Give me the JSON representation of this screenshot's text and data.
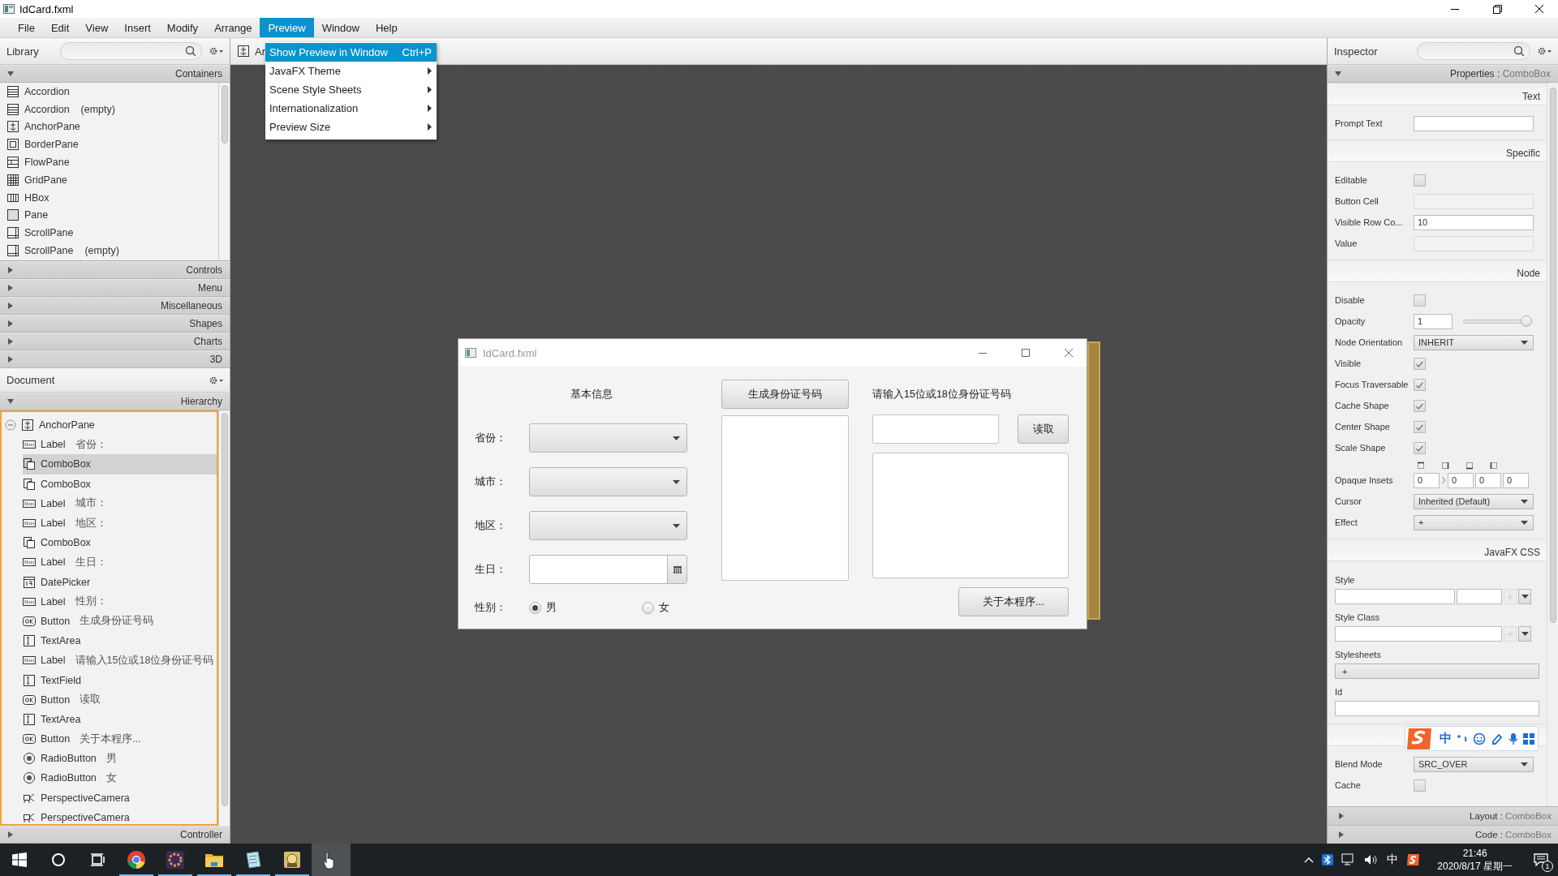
{
  "window": {
    "title": "IdCard.fxml"
  },
  "menu_bar": [
    {
      "label": "File",
      "selected": false
    },
    {
      "label": "Edit",
      "selected": false
    },
    {
      "label": "View",
      "selected": false
    },
    {
      "label": "Insert",
      "selected": false
    },
    {
      "label": "Modify",
      "selected": false
    },
    {
      "label": "Arrange",
      "selected": false
    },
    {
      "label": "Preview",
      "selected": true
    },
    {
      "label": "Window",
      "selected": false
    },
    {
      "label": "Help",
      "selected": false
    }
  ],
  "preview_menu": [
    {
      "label": "Show Preview in Window",
      "shortcut": "Ctrl+P",
      "selected": true,
      "submenu": false
    },
    {
      "label": "JavaFX Theme",
      "selected": false,
      "submenu": true
    },
    {
      "label": "Scene Style Sheets",
      "selected": false,
      "submenu": true
    },
    {
      "label": "Internationalization",
      "selected": false,
      "submenu": true
    },
    {
      "label": "Preview Size",
      "selected": false,
      "submenu": true
    }
  ],
  "library": {
    "title": "Library",
    "sections": [
      {
        "label": "Containers",
        "expanded": true,
        "items": [
          {
            "label": "Accordion",
            "kind": "accordion"
          },
          {
            "label": "Accordion",
            "note": "(empty)",
            "kind": "accordion"
          },
          {
            "label": "AnchorPane",
            "kind": "anchor"
          },
          {
            "label": "BorderPane",
            "kind": "border"
          },
          {
            "label": "FlowPane",
            "kind": "flow"
          },
          {
            "label": "GridPane",
            "kind": "grid"
          },
          {
            "label": "HBox",
            "kind": "hbox"
          },
          {
            "label": "Pane",
            "kind": "pane"
          },
          {
            "label": "ScrollPane",
            "kind": "scroll"
          },
          {
            "label": "ScrollPane",
            "note": "(empty)",
            "kind": "scroll"
          }
        ]
      },
      {
        "label": "Controls",
        "expanded": false
      },
      {
        "label": "Menu",
        "expanded": false
      },
      {
        "label": "Miscellaneous",
        "expanded": false
      },
      {
        "label": "Shapes",
        "expanded": false
      },
      {
        "label": "Charts",
        "expanded": false
      },
      {
        "label": "3D",
        "expanded": false
      }
    ]
  },
  "document": {
    "title": "Document",
    "section": "Hierarchy",
    "tree": [
      {
        "label": "AnchorPane",
        "kind": "anchor",
        "expanded": true,
        "selected": false,
        "children": [
          {
            "label": "Label",
            "detail": "省份：",
            "kind": "label",
            "selected": false
          },
          {
            "label": "ComboBox",
            "kind": "combo",
            "selected": true
          },
          {
            "label": "ComboBox",
            "kind": "combo",
            "selected": false
          },
          {
            "label": "Label",
            "detail": "城市：",
            "kind": "label",
            "selected": false
          },
          {
            "label": "Label",
            "detail": "地区：",
            "kind": "label",
            "selected": false
          },
          {
            "label": "ComboBox",
            "kind": "combo",
            "selected": false
          },
          {
            "label": "Label",
            "detail": "生日：",
            "kind": "label",
            "selected": false
          },
          {
            "label": "DatePicker",
            "kind": "date",
            "selected": false
          },
          {
            "label": "Label",
            "detail": "性别：",
            "kind": "label",
            "selected": false
          },
          {
            "label": "Button",
            "detail": "生成身份证号码",
            "kind": "button",
            "selected": false
          },
          {
            "label": "TextArea",
            "kind": "textarea",
            "selected": false
          },
          {
            "label": "Label",
            "detail": "请输入15位或18位身份证号码",
            "kind": "label",
            "selected": false
          },
          {
            "label": "TextField",
            "kind": "textarea",
            "selected": false
          },
          {
            "label": "Button",
            "detail": "读取",
            "kind": "button",
            "selected": false
          },
          {
            "label": "TextArea",
            "kind": "textarea",
            "selected": false
          },
          {
            "label": "Button",
            "detail": "关于本程序...",
            "kind": "button",
            "selected": false
          },
          {
            "label": "RadioButton",
            "detail": "男",
            "kind": "radio",
            "selected": false
          },
          {
            "label": "RadioButton",
            "detail": "女",
            "kind": "radio",
            "selected": false
          },
          {
            "label": "PerspectiveCamera",
            "kind": "camera",
            "selected": false
          },
          {
            "label": "PerspectiveCamera",
            "kind": "camera",
            "selected": false
          }
        ]
      }
    ],
    "footer": "Controller"
  },
  "canvas": {
    "breadcrumb": "Ar"
  },
  "preview_window": {
    "title": "IdCard.fxml",
    "heading": "基本信息",
    "fields": [
      {
        "label": "省份：",
        "kind": "combo"
      },
      {
        "label": "城市：",
        "kind": "combo"
      },
      {
        "label": "地区：",
        "kind": "combo"
      },
      {
        "label": "生日：",
        "kind": "date"
      }
    ],
    "gender_label": "性别：",
    "radios": [
      {
        "label": "男",
        "selected": true
      },
      {
        "label": "女",
        "selected": false
      }
    ],
    "generate_button": "生成身份证号码",
    "id_prompt": "请输入15位或18位身份证号码",
    "read_button": "读取",
    "about_button": "关于本程序..."
  },
  "inspector": {
    "title": "Inspector",
    "header": {
      "label": "Properties :",
      "target": "ComboBox"
    },
    "sections": [
      {
        "title": "Text",
        "rows": [
          {
            "label": "Prompt Text",
            "kind": "text"
          }
        ]
      },
      {
        "title": "Specific",
        "rows": [
          {
            "label": "Editable",
            "kind": "checkbox",
            "checked": false
          },
          {
            "label": "Button Cell",
            "kind": "readonly"
          },
          {
            "label": "Visible Row Co...",
            "kind": "text",
            "value": "10"
          },
          {
            "label": "Value",
            "kind": "readonly"
          }
        ]
      },
      {
        "title": "Node",
        "rows": [
          {
            "label": "Disable",
            "kind": "checkbox",
            "checked": false
          },
          {
            "label": "Opacity",
            "kind": "slider",
            "value": "1",
            "level": 1
          },
          {
            "label": "Node Orientation",
            "kind": "choice",
            "value": "INHERIT"
          },
          {
            "label": "Visible",
            "kind": "checkbox",
            "checked": true
          },
          {
            "label": "Focus Traversable",
            "kind": "checkbox",
            "checked": true
          },
          {
            "label": "Cache Shape",
            "kind": "checkbox",
            "checked": true
          },
          {
            "label": "Center Shape",
            "kind": "checkbox",
            "checked": true
          },
          {
            "label": "Scale Shape",
            "kind": "checkbox",
            "checked": true
          },
          {
            "label": "Opaque Insets",
            "kind": "insets",
            "values": [
              "0",
              "0",
              "0",
              "0"
            ]
          },
          {
            "label": "Cursor",
            "kind": "choice",
            "value": "Inherited (Default)"
          },
          {
            "label": "Effect",
            "kind": "choice",
            "value": "+"
          }
        ]
      },
      {
        "title": "JavaFX CSS",
        "rows": [
          {
            "label": "Style",
            "kind": "style"
          },
          {
            "label": "Style Class",
            "kind": "styleclass"
          },
          {
            "label": "Stylesheets",
            "kind": "list",
            "value": "+"
          },
          {
            "label": "Id",
            "kind": "block"
          }
        ]
      },
      {
        "rows": [
          {
            "label": "Blend Mode",
            "kind": "choice",
            "value": "SRC_OVER"
          },
          {
            "label": "Cache",
            "kind": "checkbox",
            "checked": false
          }
        ]
      }
    ],
    "footers": [
      {
        "label": "Layout :",
        "target": "ComboBox"
      },
      {
        "label": "Code :",
        "target": "ComboBox"
      }
    ]
  },
  "ime_toolbar": {
    "mode": "中"
  },
  "taskbar": {
    "apps": [
      {
        "kind": "browser",
        "active": false
      },
      {
        "kind": "ide",
        "active": false
      },
      {
        "kind": "folder",
        "active": false
      },
      {
        "kind": "notepad",
        "active": false
      },
      {
        "kind": "cartoon",
        "active": false
      },
      {
        "kind": "pointer",
        "active": true
      }
    ],
    "tray": {
      "ime": "中",
      "time": "21:46",
      "date": "2020/8/17 星期一",
      "notifications": "1"
    }
  }
}
